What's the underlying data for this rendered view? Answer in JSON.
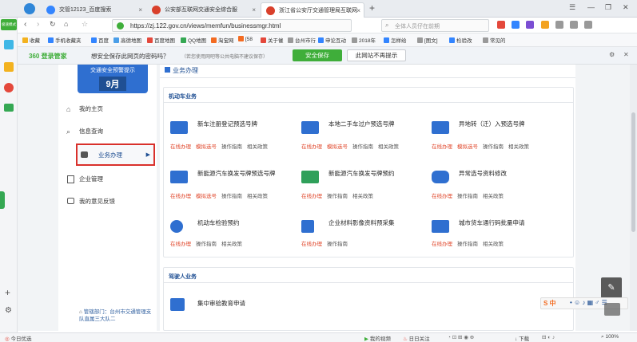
{
  "tabs": [
    {
      "label": "交管12123_百度搜索",
      "close": "×"
    },
    {
      "label": "公安部互联网交通安全综合服",
      "close": "×"
    },
    {
      "label": "浙江省公安厅交通管理局互联网",
      "close": "×"
    }
  ],
  "new_tab": "+",
  "window_controls": {
    "menu": "☰",
    "min": "—",
    "restore": "❐",
    "close": "✕"
  },
  "address": {
    "url": "https://zj.122.gov.cn/views/memfun/businessmgr.html",
    "search_placeholder": "全体人员仔在前期"
  },
  "bookmarks": [
    {
      "label": "收藏"
    },
    {
      "label": "手机收藏夹"
    },
    {
      "label": "百度"
    },
    {
      "label": "高德地图"
    },
    {
      "label": "百度地图"
    },
    {
      "label": "QQ地图"
    },
    {
      "label": "淘宝网"
    },
    {
      "label": "[58"
    },
    {
      "label": "关于催"
    },
    {
      "label": "台州市行"
    },
    {
      "label": "申论互动"
    },
    {
      "label": "2018年"
    },
    {
      "label": "怎样给"
    },
    {
      "label": "[图文]"
    },
    {
      "label": "检验改"
    },
    {
      "label": "常见的"
    }
  ],
  "password_bar": {
    "brand": "360 登录管家",
    "message": "想安全保存此网页的密码吗？",
    "hint": "（若您使用网吧等公共电脑不建议保存）",
    "save_label": "安全保存",
    "never_label": "此网站不再提示"
  },
  "left_strip": {
    "badge": "极速模式"
  },
  "banner": {
    "line1": "交通安全预警提示",
    "line2": "9月"
  },
  "sidebar": {
    "items": [
      {
        "label": "我的主页"
      },
      {
        "label": "信息查询"
      },
      {
        "label": "业务办理"
      },
      {
        "label": "企业管理"
      },
      {
        "label": "我的意见反馈"
      }
    ],
    "footer": "管辖部门：台州市交通管理支队直属三大队二"
  },
  "main": {
    "header": "业务办理",
    "section1": "机动车业务",
    "section2": "驾驶人业务",
    "services": [
      {
        "title": "新车注册登记预选号牌",
        "links": [
          "在线办理",
          "模拟选号",
          "操作指南",
          "相关政策"
        ]
      },
      {
        "title": "本地二手车过户预选号牌",
        "links": [
          "在线办理",
          "模拟选号",
          "操作指南",
          "相关政策"
        ]
      },
      {
        "title": "异地转（迁）入预选号牌",
        "links": [
          "在线办理",
          "模拟选号",
          "操作指南",
          "相关政策"
        ]
      },
      {
        "title": "新能源汽车换发号牌预选号牌",
        "links": [
          "在线办理",
          "模拟选号",
          "操作指南",
          "相关政策"
        ]
      },
      {
        "title": "新能源汽车换发号牌预约",
        "links": [
          "在线办理",
          "操作指南",
          "相关政策"
        ]
      },
      {
        "title": "异常选号资料修改",
        "links": [
          "在线办理",
          "操作指南",
          "相关政策"
        ]
      },
      {
        "title": "机动车检验预约",
        "links": [
          "在线办理",
          "操作指南",
          "相关政策"
        ]
      },
      {
        "title": "企业材料影像资料预采集",
        "links": [
          "在线办理",
          "操作指南"
        ]
      },
      {
        "title": "城市货车通行码批量申请",
        "links": [
          "在线办理",
          "操作指南",
          "相关政策"
        ]
      },
      {
        "title": "集中审验教育申请",
        "links": []
      }
    ]
  },
  "statusbar": {
    "left": "今日优选",
    "video": "我的视频",
    "follow": "日日关注",
    "download": "下载",
    "zoom": "100%"
  },
  "ime": {
    "label": "S 中"
  },
  "colors": {
    "accent_red": "#e0472b",
    "brand_blue": "#1f4f93",
    "save_green": "#3fae3a"
  }
}
